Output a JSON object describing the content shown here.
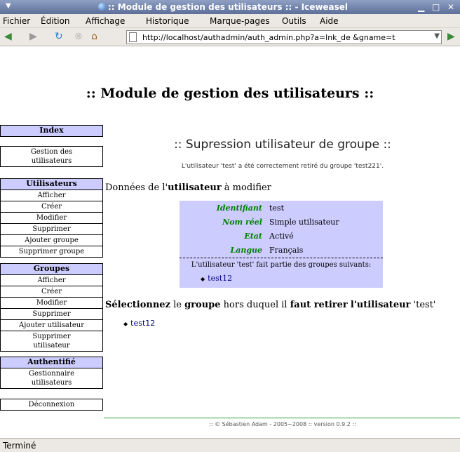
{
  "window": {
    "title": ":: Module de gestion des utilisateurs :: - Iceweasel",
    "menu_glyph": "▼",
    "controls": {
      "minimize": "▁",
      "maximize": "□",
      "close": "✕"
    }
  },
  "menubar": {
    "items": [
      "Fichier",
      "Édition",
      "Affichage",
      "Historique",
      "Marque-pages",
      "Outils",
      "Aide"
    ]
  },
  "navbar": {
    "back": "◀",
    "forward": "▶",
    "reload": "↻",
    "stop": "⊗",
    "home": "⌂",
    "url": "http://localhost/authadmin/auth_admin.php?a=lnk_de &gname=t",
    "go": "▶"
  },
  "page": {
    "title": ":: Module de gestion des utilisateurs ::",
    "sidebar": {
      "index": "Index",
      "gestion": [
        "Gestion des",
        "utilisateurs"
      ],
      "utilisateurs": {
        "heading": "Utilisateurs",
        "items": [
          "Afficher",
          "Créer",
          "Modifier",
          "Supprimer",
          "Ajouter groupe",
          "Supprimer groupe"
        ]
      },
      "groupes": {
        "heading": "Groupes",
        "items": [
          "Afficher",
          "Créer",
          "Modifier",
          "Supprimer",
          "Ajouter utilisateur"
        ],
        "last": [
          "Supprimer",
          "utilisateur"
        ]
      },
      "authentifie": {
        "heading": "Authentifié",
        "item": [
          "Gestionnaire",
          "utilisateurs"
        ]
      },
      "logout": "Déconnexion"
    },
    "main": {
      "heading": ":: Supression utilisateur de groupe ::",
      "success": "L'utilisateur 'test' a été correctement retiré du groupe 'test221'.",
      "user_heading_pre": "Données de l'",
      "user_heading_bold": "utilisateur",
      "user_heading_post": " à modifier",
      "info": {
        "identifiant_label": "Identifiant",
        "identifiant": "test",
        "nom_label": "Nom réel",
        "nom": "Simple utilisateur",
        "etat_label": "Etat",
        "etat": "Activé",
        "langue_label": "Langue",
        "langue": "Français",
        "groups_msg": "L'utilisateur 'test' fait partie des groupes suivants:",
        "group": "test12"
      },
      "remove_heading": {
        "p1": "Sélectionnez",
        "p2": " le ",
        "p3": "groupe",
        "p4": " hors duquel il ",
        "p5": "faut retirer",
        "p6": " ",
        "p7": "l'utilisateur",
        "p8": " 'test'"
      },
      "remove_link": "test12"
    },
    "footer": ":: © Sébastien Adam - 2005~2008 :: version 0.9.2 ::"
  },
  "statusbar": {
    "text": "Terminé"
  }
}
